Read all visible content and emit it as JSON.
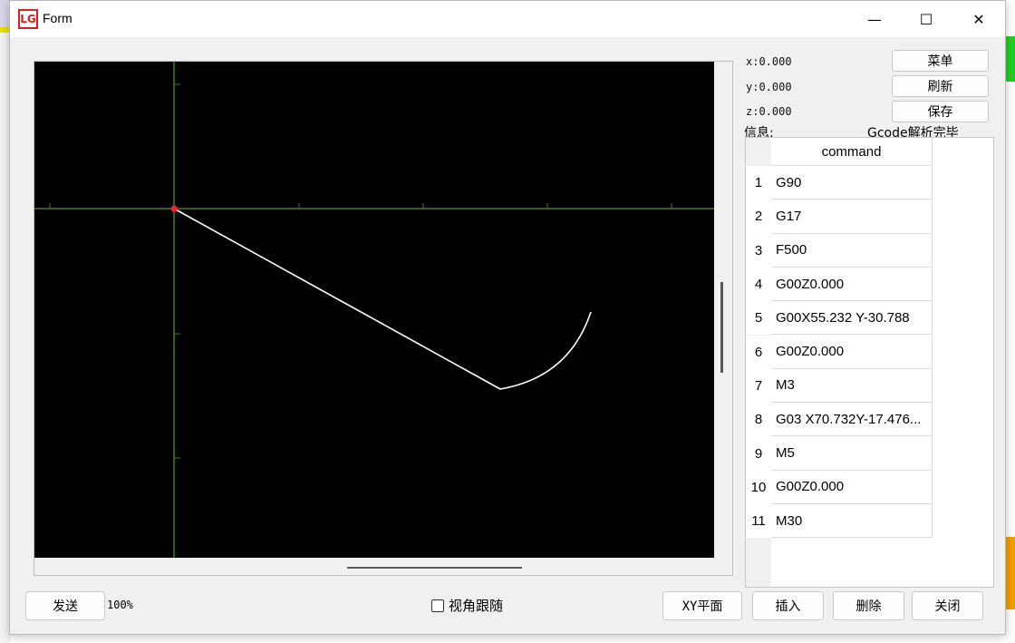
{
  "window": {
    "title": "Form",
    "app_icon": "LG"
  },
  "controls": {
    "minimize": "—",
    "maximize": "☐",
    "close": "✕"
  },
  "coords": {
    "x": "x:0.000",
    "y": "y:0.000",
    "z": "z:0.000"
  },
  "buttons": {
    "menu": "菜单",
    "refresh": "刷新",
    "save": "保存",
    "send": "发送",
    "xy_plane": "XY平面",
    "insert": "插入",
    "delete": "删除",
    "close": "关闭"
  },
  "info": {
    "label": "信息:",
    "value": "Gcode解析完毕"
  },
  "table": {
    "header": "command",
    "rows": [
      {
        "num": "1",
        "cmd": "G90"
      },
      {
        "num": "2",
        "cmd": "G17"
      },
      {
        "num": "3",
        "cmd": "F500"
      },
      {
        "num": "4",
        "cmd": "G00Z0.000"
      },
      {
        "num": "5",
        "cmd": "G00X55.232 Y-30.788"
      },
      {
        "num": "6",
        "cmd": "G00Z0.000"
      },
      {
        "num": "7",
        "cmd": "M3"
      },
      {
        "num": "8",
        "cmd": "G03 X70.732Y-17.476..."
      },
      {
        "num": "9",
        "cmd": "M5"
      },
      {
        "num": "10",
        "cmd": "G00Z0.000"
      },
      {
        "num": "11",
        "cmd": "M30"
      }
    ]
  },
  "zoom": "100%",
  "follow_view": {
    "label": "视角跟随",
    "checked": false
  },
  "colors": {
    "canvas_bg": "#000000",
    "axis": "#4a7a2a",
    "path": "#ffffff",
    "origin": "#ff2020"
  }
}
